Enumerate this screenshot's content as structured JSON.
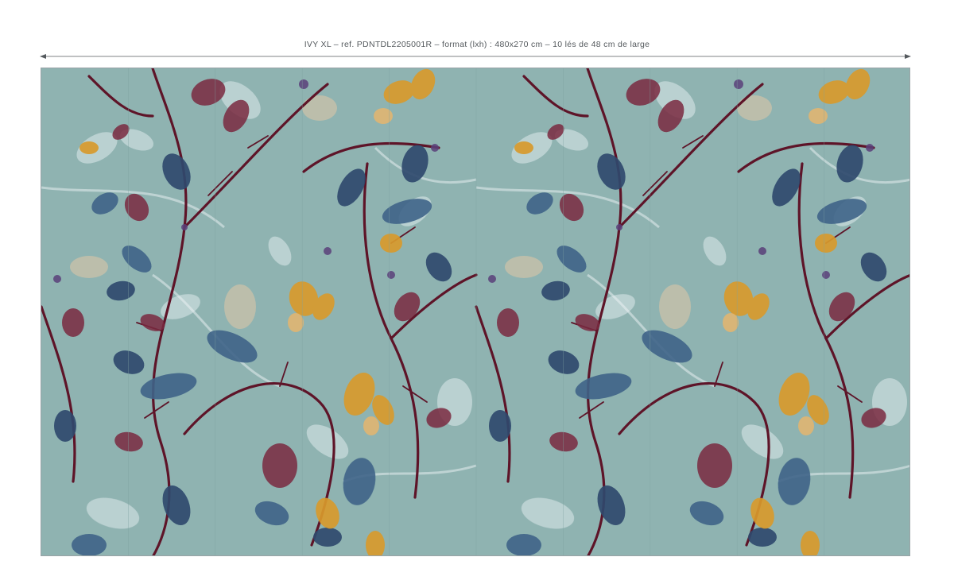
{
  "spec": {
    "caption": "IVY XL  – ref. PDNTDL2205001R – format (lxh) : 480x270 cm – 10 lés de 48 cm de large",
    "strip_count": 10
  },
  "palette": {
    "background": "#8fb3b1",
    "stem": "#5e1428",
    "navy": "#2f4a6e",
    "blue": "#3f6488",
    "plum": "#7a2a40",
    "ochre": "#d89a2c",
    "pale": "#dfe9ec",
    "ghost_peach": "#e9c9a5"
  }
}
